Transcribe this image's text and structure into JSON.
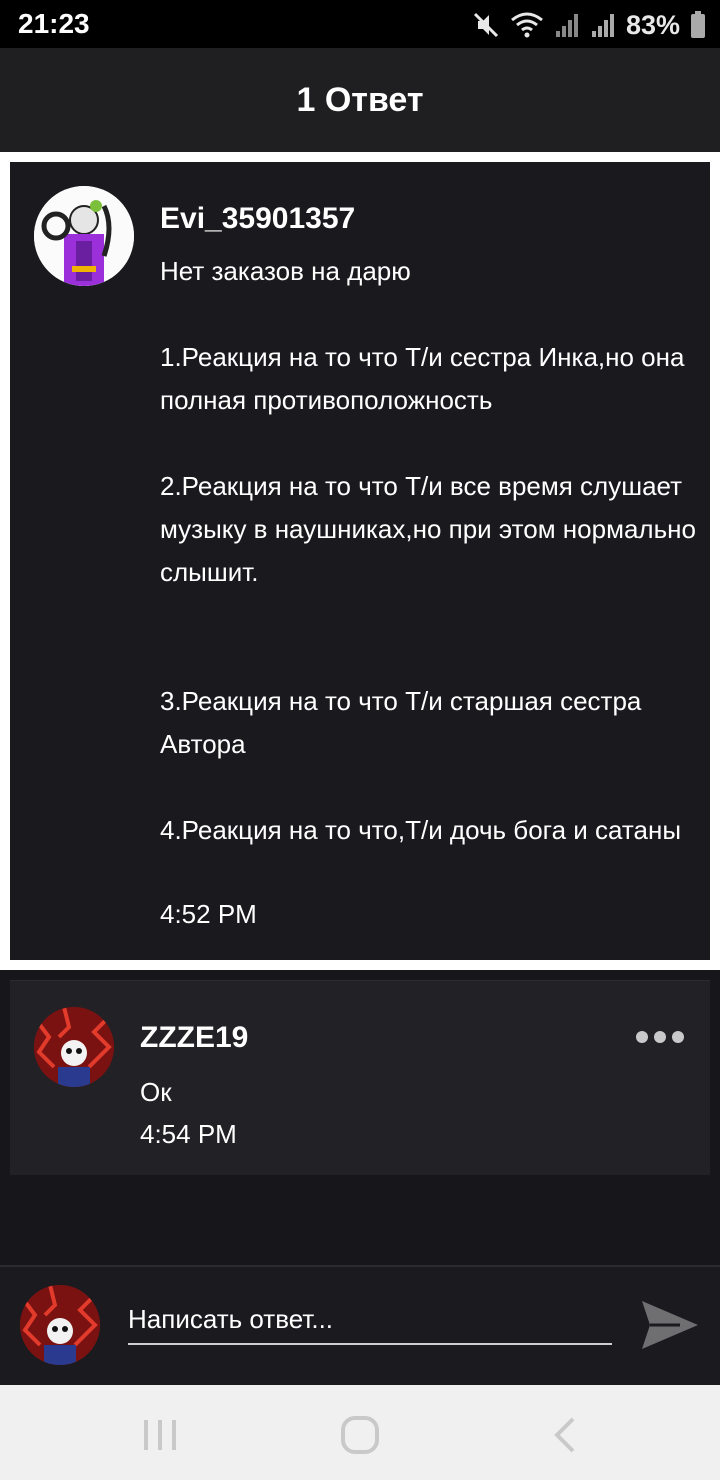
{
  "status_bar": {
    "time": "21:23",
    "battery": "83%",
    "icons": [
      "mute-icon",
      "wifi-icon",
      "signal-icon",
      "signal-icon",
      "battery-icon"
    ]
  },
  "header": {
    "title": "1 Ответ"
  },
  "original_post": {
    "author": "Evi_35901357",
    "text": "Нет заказов на дарю\n\n1.Реакция на то что Т/и сестра Инка,но она полная противоположность\n\n2.Реакция на то что Т/и все время слушает музыку в наушниках,но при этом нормально слышит.\n\n\n3.Реакция на то что Т/и старшая сестра Автора\n\n4.Реакция на то что,Т/и дочь бога и сатаны",
    "time": "4:52 PM"
  },
  "reply": {
    "author": "ZZZE19",
    "text": "Ок",
    "time": "4:54 PM",
    "more_icon": "more-horizontal-icon"
  },
  "composer": {
    "placeholder": "Написать ответ...",
    "send_icon": "send-icon"
  },
  "nav_bar": {
    "icons": [
      "recents-icon",
      "home-icon",
      "back-icon"
    ]
  },
  "colors": {
    "background": "#17161a",
    "header": "#1f1f21",
    "post_border": "#ffffff",
    "reply_card": "#222125",
    "nav_bar": "#f0f0f0"
  }
}
